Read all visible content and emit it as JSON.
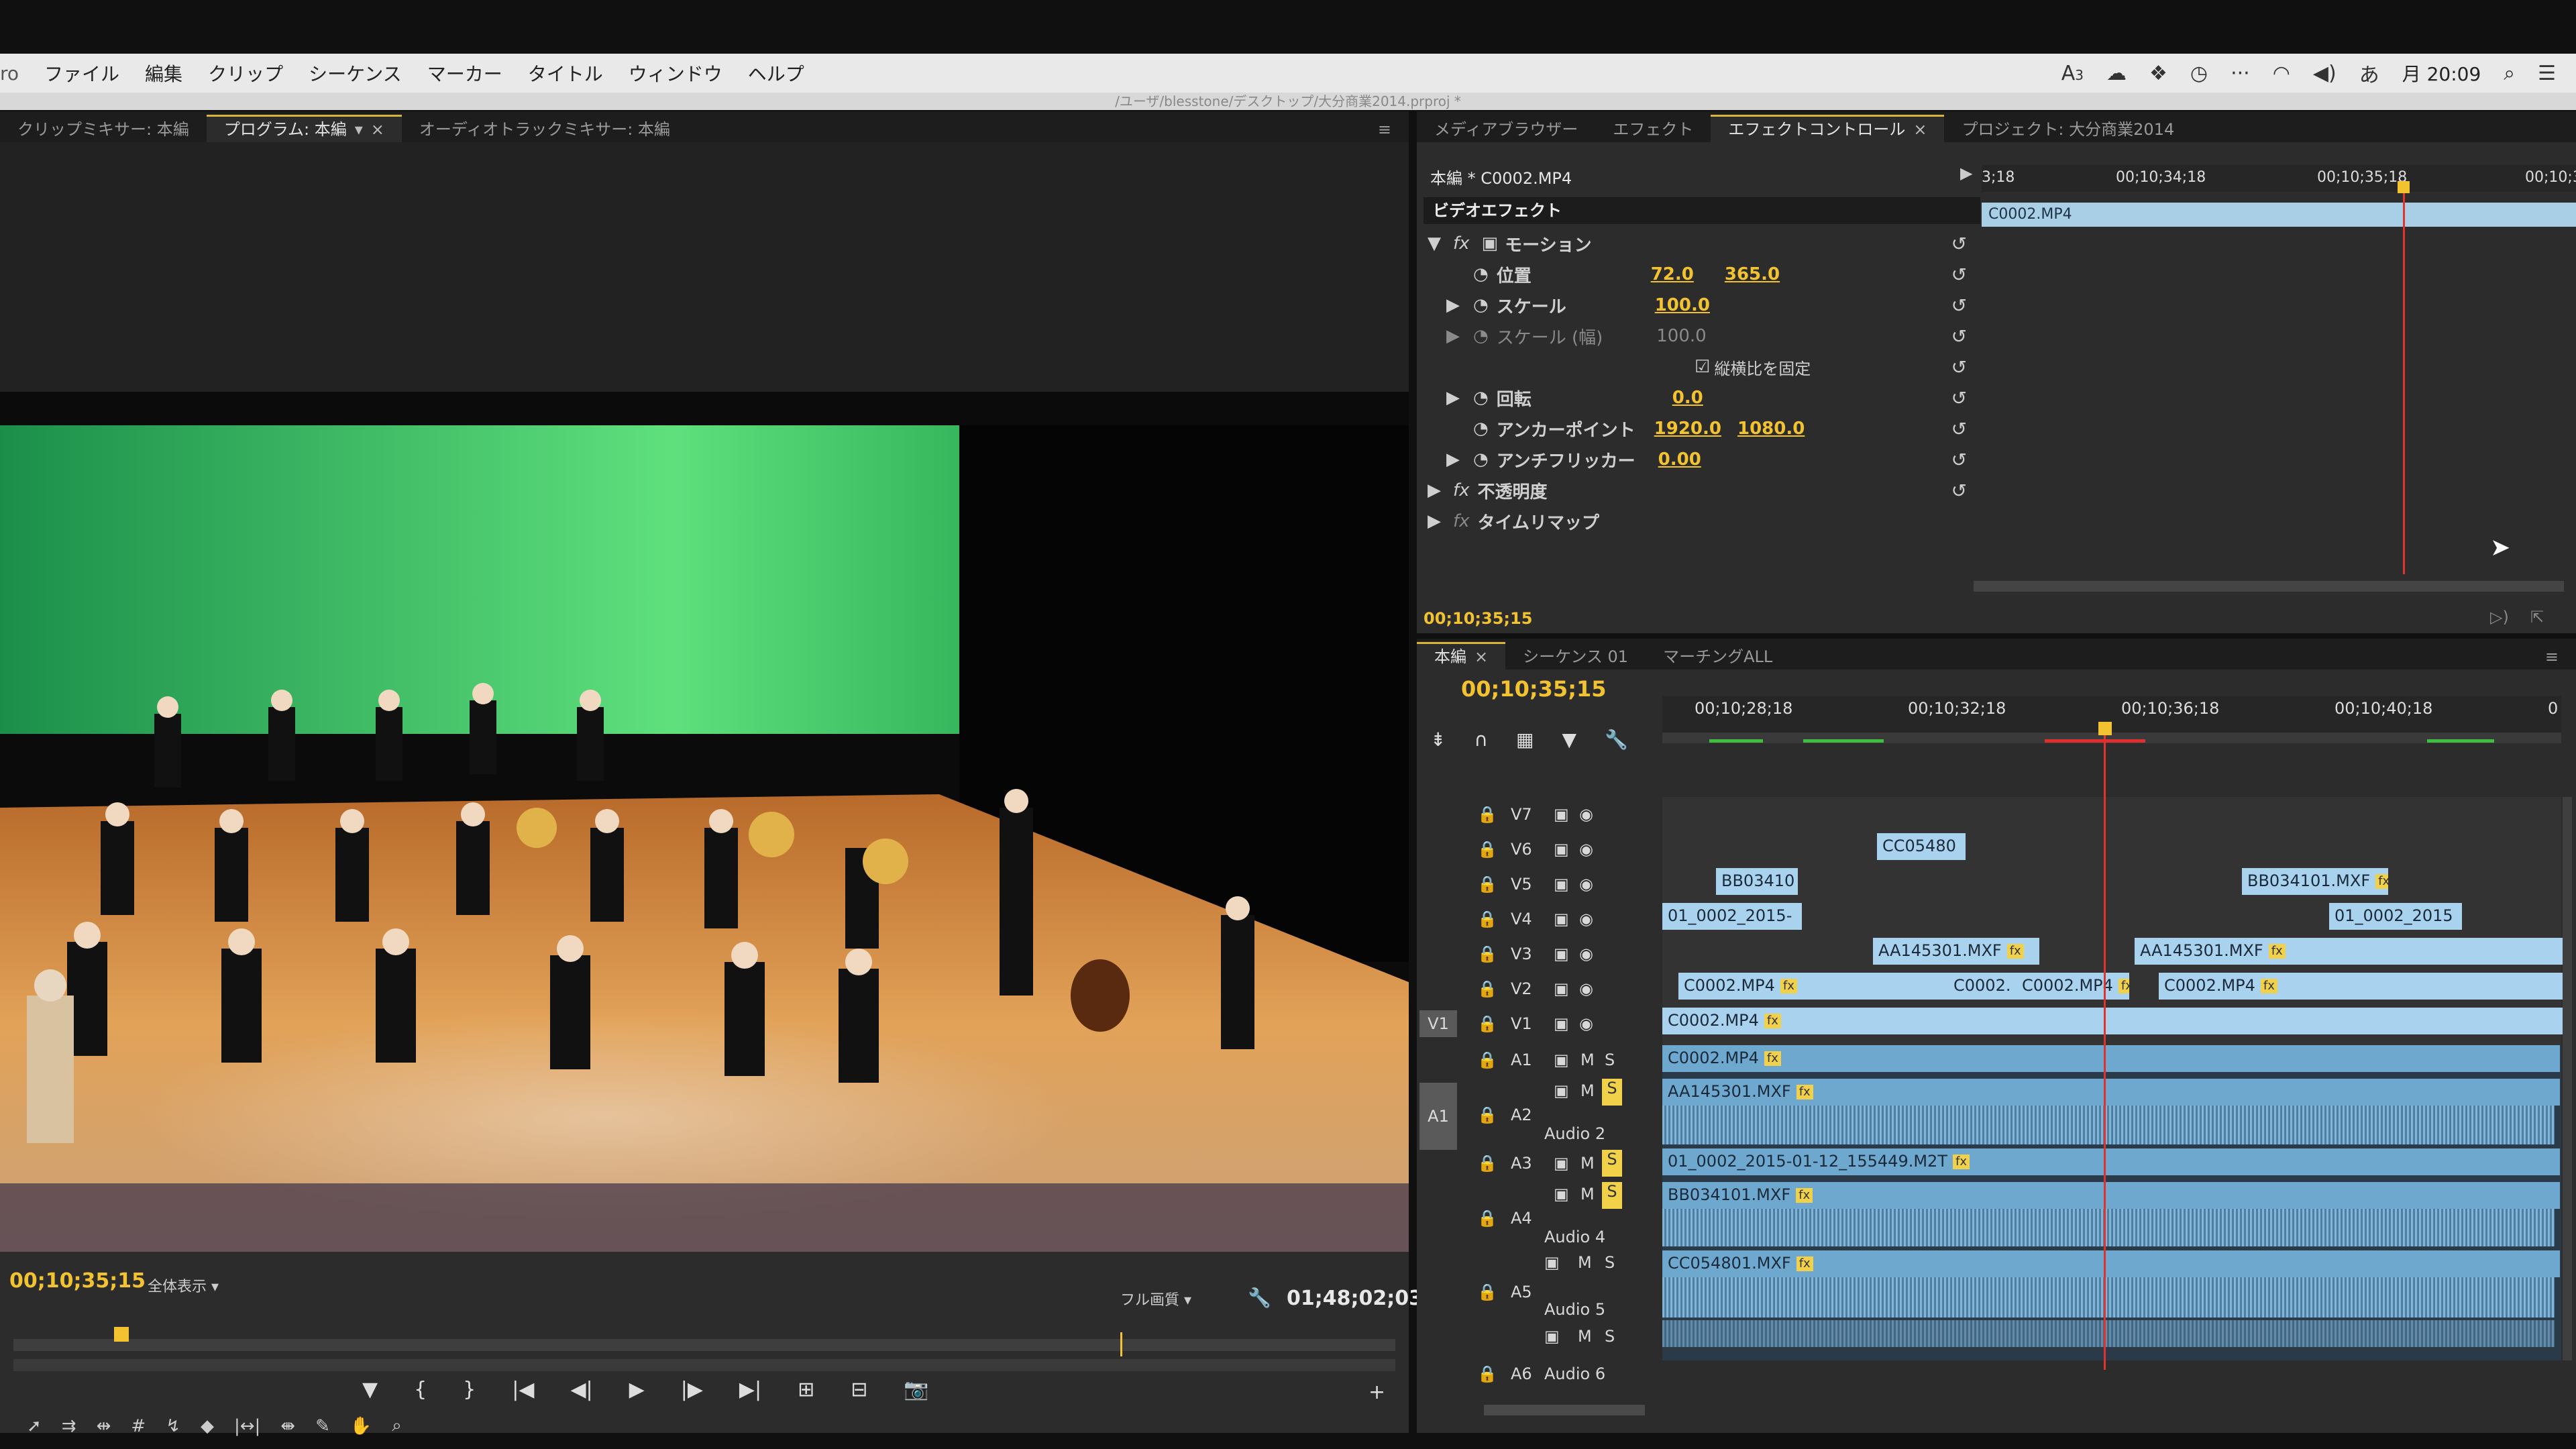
{
  "menubar": {
    "app_fragment": "ro",
    "items": [
      "ファイル",
      "編集",
      "クリップ",
      "シーケンス",
      "マーカー",
      "タイトル",
      "ウィンドウ",
      "ヘルプ"
    ],
    "clock": "月 20:09",
    "badge": "3"
  },
  "project_path": "/ユーザ/blesstone/デスクトップ/大分商業2014.prproj *",
  "program": {
    "tabs": [
      "クリップミキサー: 本編",
      "プログラム: 本編",
      "オーディオトラックミキサー: 本編"
    ],
    "current_time": "00;10;35;15",
    "zoom": "全体表示",
    "quality": "フル画質",
    "duration": "01;48;02;03"
  },
  "effects": {
    "tabs": [
      "メディアブラウザー",
      "エフェクト",
      "エフェクトコントロール",
      "プロジェクト: 大分商業2014"
    ],
    "clip_title": "本編 * C0002.MP4",
    "section": "ビデオエフェクト",
    "motion": "モーション",
    "position_label": "位置",
    "position_x": "72.0",
    "position_y": "365.0",
    "scale_label": "スケール",
    "scale": "100.0",
    "scale_w_label": "スケール (幅)",
    "scale_w": "100.0",
    "uniform": "縦横比を固定",
    "rotation_label": "回転",
    "rotation": "0.0",
    "anchor_label": "アンカーポイント",
    "anchor_x": "1920.0",
    "anchor_y": "1080.0",
    "flicker_label": "アンチフリッカー",
    "flicker": "0.00",
    "opacity": "不透明度",
    "remap": "タイムリマップ",
    "ruler": [
      "3;18",
      "00;10;34;18",
      "00;10;35;18",
      "00;10;3"
    ],
    "mini_clip": "C0002.MP4",
    "time": "00;10;35;15"
  },
  "timeline": {
    "tabs": [
      "本編",
      "シーケンス 01",
      "マーチングALL"
    ],
    "current_time": "00;10;35;15",
    "ruler": [
      "00;10;28;18",
      "00;10;32;18",
      "00;10;36;18",
      "00;10;40;18",
      "0"
    ],
    "video_tracks": [
      "V7",
      "V6",
      "V5",
      "V4",
      "V3",
      "V2",
      "V1"
    ],
    "audio_tracks": [
      "A1",
      "A2",
      "A3",
      "A4",
      "A5",
      "A6"
    ],
    "audio_names": [
      "Audio 2",
      "Audio 4",
      "Audio 5",
      "Audio 6"
    ],
    "src_v": "V1",
    "src_a": "A1",
    "clips": {
      "v6_a": "CC05480",
      "v5_a": "BB03410",
      "v5_b": "BB034101.MXF",
      "v4_a": "01_0002_2015-",
      "v4_b": "01_0002_2015",
      "v3_a": "AA145301.MXF",
      "v3_b": "AA145301.MXF",
      "v2_a": "C0002.MP4",
      "v2_b": "C0002.",
      "v2_c": "C0002.MP4",
      "v2_d": "C0002.MP4",
      "v1_a": "C0002.MP4",
      "a1": "C0002.MP4",
      "a2": "AA145301.MXF",
      "a3": "01_0002_2015-01-12_155449.M2T",
      "a4": "BB034101.MXF",
      "a5": "CC054801.MXF"
    },
    "m": "M",
    "s": "S"
  }
}
